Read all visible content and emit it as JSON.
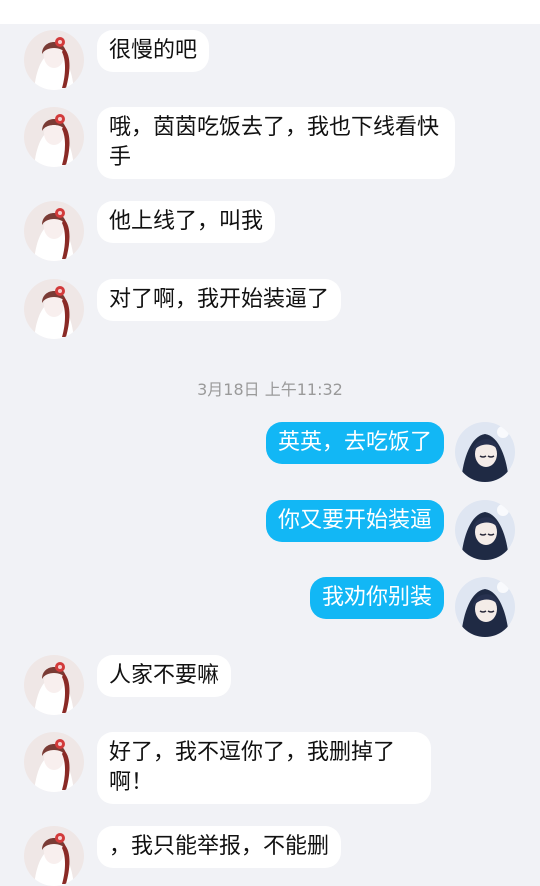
{
  "conversation": {
    "messages_before": [
      {
        "text": "很慢的吧"
      },
      {
        "text": "哦，茵茵吃饭去了，我也下线看快手"
      },
      {
        "text": "他上线了，叫我"
      },
      {
        "text": "对了啊，我开始装逼了"
      }
    ],
    "timestamp": "3月18日 上午11:32",
    "messages_out": [
      {
        "text": "英英，去吃饭了"
      },
      {
        "text": "你又要开始装逼"
      },
      {
        "text": "我劝你别装"
      }
    ],
    "messages_after": [
      {
        "text": "人家不要嘛"
      },
      {
        "text": "好了，我不逗你了，我删掉了啊！"
      },
      {
        "text": "，我只能举报，不能删"
      }
    ]
  },
  "colors": {
    "background": "#f1f2f6",
    "incoming_bubble": "#ffffff",
    "outgoing_bubble": "#12b7f5",
    "timestamp_text": "#9a9a9a"
  },
  "icons": {
    "contact_avatar": "avatar-girl-red-hair-icon",
    "self_avatar": "avatar-girl-dark-hair-icon"
  }
}
